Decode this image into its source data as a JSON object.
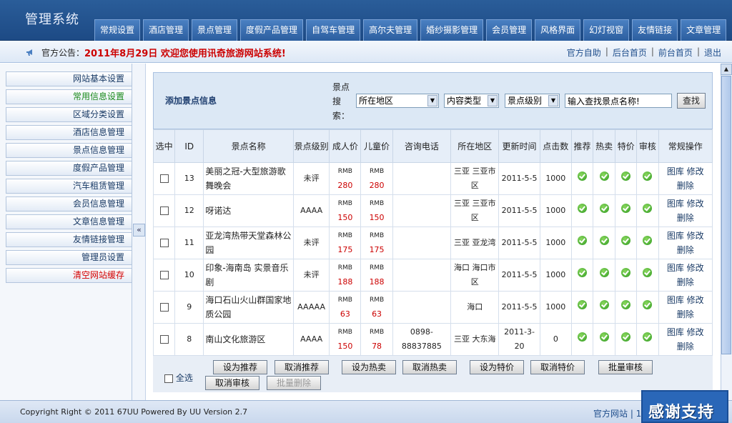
{
  "app": {
    "title": "管理系统"
  },
  "nav": [
    "常规设置",
    "酒店管理",
    "景点管理",
    "度假产品管理",
    "自驾车管理",
    "高尔夫管理",
    "婚纱摄影管理",
    "会员管理",
    "风格界面",
    "幻灯视窗",
    "友情链接",
    "文章管理"
  ],
  "notice": {
    "label": "官方公告：",
    "text": "2011年8月29日 欢迎您使用讯奇旅游网站系统!"
  },
  "top_links": [
    "官方自助",
    "后台首页",
    "前台首页",
    "退出"
  ],
  "sidebar": {
    "items": [
      "网站基本设置",
      "常用信息设置",
      "区域分类设置",
      "酒店信息管理",
      "景点信息管理",
      "度假产品管理",
      "汽车租赁管理",
      "会员信息管理",
      "文章信息管理",
      "友情链接管理",
      "管理员设置",
      "清空网站缓存"
    ],
    "colors": {
      "active": "#1b8a1b",
      "danger": "#d40000"
    }
  },
  "panel": {
    "title": "添加景点信息",
    "search_label": "景点搜索：",
    "region": "所在地区",
    "content_type": "内容类型",
    "level": "景点级别",
    "search_value": "输入查找景点名称!",
    "search_button": "查找"
  },
  "table": {
    "headers": [
      "选中",
      "ID",
      "景点名称",
      "景点级别",
      "成人价",
      "儿童价",
      "咨询电话",
      "所在地区",
      "更新时间",
      "点击数",
      "推荐",
      "热卖",
      "特价",
      "审核",
      "常规操作"
    ],
    "rows": [
      {
        "id": "13",
        "name": "美丽之冠-大型旅游歌舞晚会",
        "level": "未评",
        "adult": "280",
        "child": "280",
        "phone": "",
        "region": "三亚 三亚市区",
        "updated": "2011-5-5",
        "clicks": "1000"
      },
      {
        "id": "12",
        "name": "呀诺达",
        "level": "AAAA",
        "adult": "150",
        "child": "150",
        "phone": "",
        "region": "三亚 三亚市区",
        "updated": "2011-5-5",
        "clicks": "1000"
      },
      {
        "id": "11",
        "name": "亚龙湾热带天堂森林公园",
        "level": "未评",
        "adult": "175",
        "child": "175",
        "phone": "",
        "region": "三亚 亚龙湾",
        "updated": "2011-5-5",
        "clicks": "1000"
      },
      {
        "id": "10",
        "name": "印象-海南岛 实景音乐剧",
        "level": "未评",
        "adult": "188",
        "child": "188",
        "phone": "",
        "region": "海口 海口市区",
        "updated": "2011-5-5",
        "clicks": "1000"
      },
      {
        "id": "9",
        "name": "海口石山火山群国家地质公园",
        "level": "AAAAA",
        "adult": "63",
        "child": "63",
        "phone": "",
        "region": "海口",
        "updated": "2011-5-5",
        "clicks": "1000"
      },
      {
        "id": "8",
        "name": "南山文化旅游区",
        "level": "AAAA",
        "adult": "150",
        "child": "78",
        "phone": "0898-88837885",
        "region": "三亚 大东海",
        "updated": "2011-3-20",
        "clicks": "0"
      }
    ],
    "currency": "RMB",
    "ops": [
      "图库",
      "修改",
      "删除"
    ]
  },
  "actions": {
    "select_all": "全选",
    "buttons": [
      "设为推荐",
      "取消推荐",
      "设为热卖",
      "取消热卖",
      "设为特价",
      "取消特价",
      "批量审核",
      "取消审核",
      "批量删除"
    ]
  },
  "footer": {
    "copyright": "Copyright Right © 2011 67UU Powered By UU Version 2.7",
    "link": "官方网站 | 1"
  },
  "thanks": "感谢支持"
}
